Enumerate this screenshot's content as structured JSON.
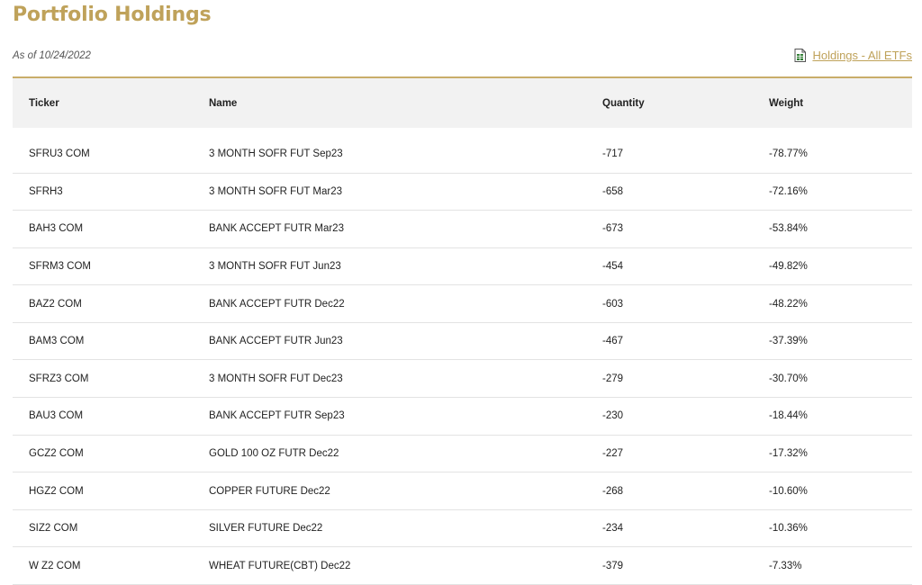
{
  "page": {
    "title": "Portfolio Holdings",
    "as_of": "As of 10/24/2022",
    "download_link": "Holdings - All ETFs",
    "accent_color": "#bfa25a",
    "icons": [
      "spreadsheet-icon"
    ]
  },
  "table": {
    "columns": [
      "Ticker",
      "Name",
      "Quantity",
      "Weight"
    ],
    "rows": [
      {
        "ticker": "SFRU3 COM",
        "name": "3 MONTH SOFR FUT Sep23",
        "quantity": "-717",
        "weight": "-78.77%"
      },
      {
        "ticker": "SFRH3",
        "name": "3 MONTH SOFR FUT Mar23",
        "quantity": "-658",
        "weight": "-72.16%"
      },
      {
        "ticker": "BAH3 COM",
        "name": "BANK ACCEPT FUTR Mar23",
        "quantity": "-673",
        "weight": "-53.84%"
      },
      {
        "ticker": "SFRM3 COM",
        "name": "3 MONTH SOFR FUT Jun23",
        "quantity": "-454",
        "weight": "-49.82%"
      },
      {
        "ticker": "BAZ2 COM",
        "name": "BANK ACCEPT FUTR Dec22",
        "quantity": "-603",
        "weight": "-48.22%"
      },
      {
        "ticker": "BAM3 COM",
        "name": "BANK ACCEPT FUTR Jun23",
        "quantity": "-467",
        "weight": "-37.39%"
      },
      {
        "ticker": "SFRZ3 COM",
        "name": "3 MONTH SOFR FUT Dec23",
        "quantity": "-279",
        "weight": "-30.70%"
      },
      {
        "ticker": "BAU3 COM",
        "name": "BANK ACCEPT FUTR Sep23",
        "quantity": "-230",
        "weight": "-18.44%"
      },
      {
        "ticker": "GCZ2 COM",
        "name": "GOLD 100 OZ FUTR Dec22",
        "quantity": "-227",
        "weight": "-17.32%"
      },
      {
        "ticker": "HGZ2 COM",
        "name": "COPPER FUTURE Dec22",
        "quantity": "-268",
        "weight": "-10.60%"
      },
      {
        "ticker": "SIZ2 COM",
        "name": "SILVER FUTURE Dec22",
        "quantity": "-234",
        "weight": "-10.36%"
      },
      {
        "ticker": "W Z2 COM",
        "name": "WHEAT FUTURE(CBT) Dec22",
        "quantity": "-379",
        "weight": "-7.33%"
      }
    ]
  }
}
